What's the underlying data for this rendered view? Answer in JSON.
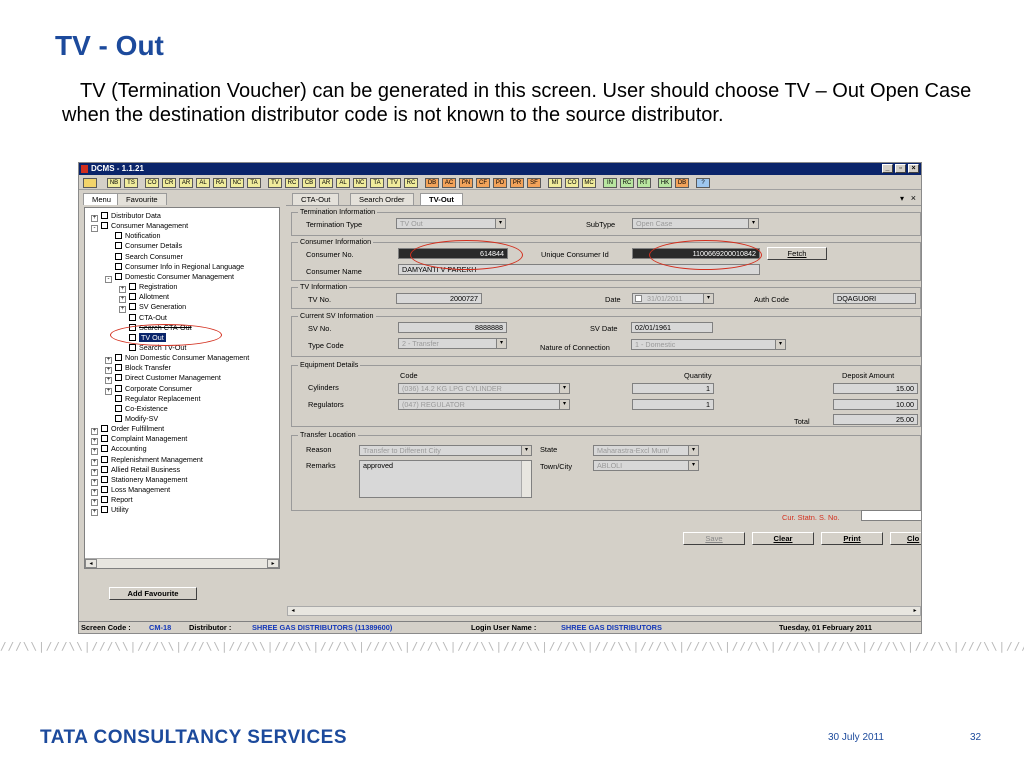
{
  "slide": {
    "title": "TV - Out",
    "intro": "TV (Termination Voucher) can be generated in this screen. User should choose TV – Out Open Case when the destination distributor code is not known to the source distributor.",
    "brand": "TATA CONSULTANCY SERVICES",
    "date": "30 July 2011",
    "page": "32",
    "pattern": "///\\\\|///\\\\|///\\\\|///\\\\|///\\\\|///\\\\|///\\\\|///\\\\|///\\\\|///\\\\|///\\\\|///\\\\|///\\\\|///\\\\|///\\\\|///\\\\|///\\\\|///\\\\|///\\\\|///\\\\|///\\\\|///\\\\|///\\\\|///\\\\|///\\\\|///\\\\|///\\\\|///\\\\|///\\\\|///\\\\|"
  },
  "app": {
    "window_title": "DCMS - 1.1.21",
    "toolbar": [
      "NB",
      "TS",
      "CO",
      "CR",
      "AR",
      "AL",
      "RA",
      "NC",
      "TA",
      "TV",
      "RC",
      "CB",
      "AR",
      "AL",
      "NC",
      "TA",
      "TV",
      "RC",
      "DB",
      "AC",
      "PN",
      "CF",
      "PD",
      "PR",
      "SF",
      "MI",
      "CO",
      "MC",
      "IN",
      "RC",
      "RT",
      "HK",
      "DB",
      "?"
    ],
    "sidebar_tabs": [
      "Menu",
      "Favourite"
    ],
    "tree": [
      {
        "label": "Distributor Data",
        "level": 0,
        "pm": "+"
      },
      {
        "label": "Consumer Management",
        "level": 0,
        "pm": "-"
      },
      {
        "label": "Notification",
        "level": 1
      },
      {
        "label": "Consumer Details",
        "level": 1
      },
      {
        "label": "Search Consumer",
        "level": 1
      },
      {
        "label": "Consumer Info in Regional Language",
        "level": 1
      },
      {
        "label": "Domestic Consumer Management",
        "level": 1,
        "pm": "-"
      },
      {
        "label": "Registration",
        "level": 2,
        "pm": "+"
      },
      {
        "label": "Allotment",
        "level": 2,
        "pm": "+"
      },
      {
        "label": "SV Generation",
        "level": 2,
        "pm": "+"
      },
      {
        "label": "CTA-Out",
        "level": 2
      },
      {
        "label": "Search CTA-Out",
        "level": 2,
        "strike": true
      },
      {
        "label": "TV Out",
        "level": 2,
        "selected": true
      },
      {
        "label": "Search TV-Out",
        "level": 2
      },
      {
        "label": "Non Domestic Consumer Management",
        "level": 1,
        "pm": "+"
      },
      {
        "label": "Block Transfer",
        "level": 1,
        "pm": "+"
      },
      {
        "label": "Direct Customer Management",
        "level": 1,
        "pm": "+"
      },
      {
        "label": "Corporate Consumer",
        "level": 1,
        "pm": "+"
      },
      {
        "label": "Regulator Replacement",
        "level": 1
      },
      {
        "label": "Co-Existence",
        "level": 1
      },
      {
        "label": "Modify-SV",
        "level": 1
      },
      {
        "label": "Order Fulfillment",
        "level": 0,
        "pm": "+"
      },
      {
        "label": "Complaint Management",
        "level": 0,
        "pm": "+"
      },
      {
        "label": "Accounting",
        "level": 0,
        "pm": "+"
      },
      {
        "label": "Replenishment Management",
        "level": 0,
        "pm": "+"
      },
      {
        "label": "Allied Retail Business",
        "level": 0,
        "pm": "+"
      },
      {
        "label": "Stationery Management",
        "level": 0,
        "pm": "+"
      },
      {
        "label": "Loss Management",
        "level": 0,
        "pm": "+"
      },
      {
        "label": "Report",
        "level": 0,
        "pm": "+"
      },
      {
        "label": "Utility",
        "level": 0,
        "pm": "+"
      }
    ],
    "add_favourite": "Add Favourite",
    "tabs": [
      "CTA-Out",
      "Search Order",
      "TV-Out"
    ],
    "termination": {
      "legend": "Termination Information",
      "type_label": "Termination Type",
      "type_value": "TV Out",
      "subtype_label": "SubType",
      "subtype_value": "Open Case"
    },
    "consumer": {
      "legend": "Consumer Information",
      "no_label": "Consumer No.",
      "no_value": "614844",
      "uid_label": "Unique Consumer Id",
      "uid_value": "1100669200010842",
      "fetch": "Fetch",
      "name_label": "Consumer Name",
      "name_value": "DAMYANTI  V PAREKH"
    },
    "tv_info": {
      "legend": "TV Information",
      "no_label": "TV No.",
      "no_value": "2000727",
      "date_label": "Date",
      "date_value": "31/01/2011",
      "auth_label": "Auth Code",
      "auth_value": "DQAGUORI"
    },
    "sv_info": {
      "legend": "Current SV Information",
      "no_label": "SV No.",
      "no_value": "8888888",
      "date_label": "SV Date",
      "date_value": "02/01/1961",
      "type_label": "Type Code",
      "type_value": "2 - Transfer",
      "nature_label": "Nature of Connection",
      "nature_value": "1 - Domestic"
    },
    "equipment": {
      "legend": "Equipment Details",
      "col_code": "Code",
      "col_qty": "Quantity",
      "col_deposit": "Deposit Amount",
      "rows": [
        {
          "label": "Cylinders",
          "code": "(036) 14.2 KG LPG CYLINDER",
          "qty": "1",
          "deposit": "15.00"
        },
        {
          "label": "Regulators",
          "code": "(047) REGULATOR",
          "qty": "1",
          "deposit": "10.00"
        }
      ],
      "total_label": "Total",
      "total_value": "25.00"
    },
    "transfer": {
      "legend": "Transfer Location",
      "reason_label": "Reason",
      "reason_value": "Transfer to Different City",
      "state_label": "State",
      "state_value": "Maharastra-Excl Mum/",
      "remarks_label": "Remarks",
      "remarks_value": "approved",
      "town_label": "Town/City",
      "town_value": "ABLOLI"
    },
    "cur_statn_label": "Cur. Statn. S. No.",
    "buttons": {
      "save": "Save",
      "clear": "Clear",
      "print": "Print",
      "close": "Clo"
    },
    "status": {
      "screen_code_label": "Screen Code :",
      "screen_code": "CM-18",
      "distributor_label": "Distributor :",
      "distributor": "SHREE GAS DISTRIBUTORS (11389600)",
      "login_label": "Login User Name :",
      "login": "SHREE GAS DISTRIBUTORS",
      "date": "Tuesday, 01 February 2011"
    },
    "colors": {
      "accent": "#1c4a9c",
      "selection": "#0a246a",
      "annotation": "#d32f1e",
      "status_value": "#1538b8"
    }
  }
}
